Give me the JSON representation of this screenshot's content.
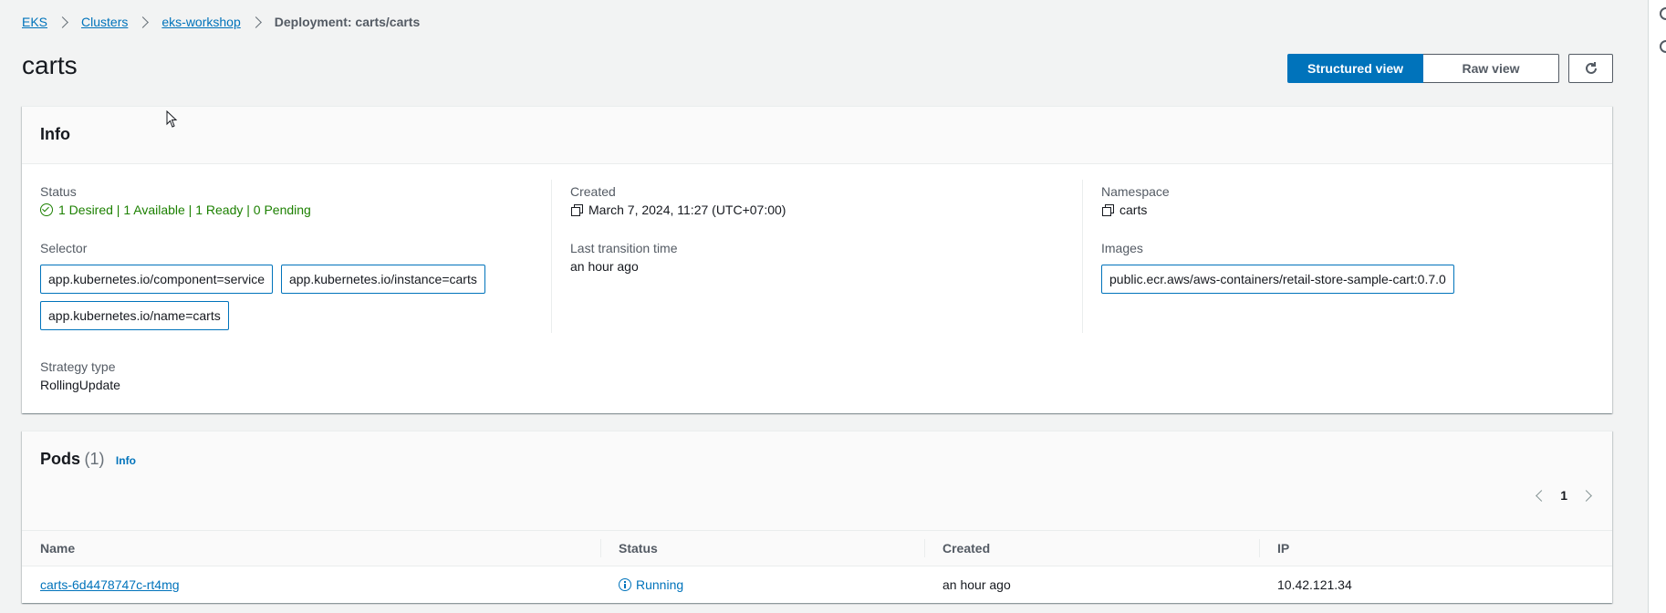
{
  "breadcrumb": {
    "items": [
      {
        "label": "EKS"
      },
      {
        "label": "Clusters"
      },
      {
        "label": "eks-workshop"
      }
    ],
    "current": "Deployment: carts/carts"
  },
  "page": {
    "title": "carts"
  },
  "toolbar": {
    "structured_view": "Structured view",
    "raw_view": "Raw view"
  },
  "info": {
    "title": "Info",
    "status": {
      "label": "Status",
      "value": "1 Desired | 1 Available | 1 Ready | 0 Pending"
    },
    "selector": {
      "label": "Selector",
      "tags": [
        "app.kubernetes.io/component=service",
        "app.kubernetes.io/instance=carts",
        "app.kubernetes.io/name=carts"
      ]
    },
    "strategy": {
      "label": "Strategy type",
      "value": "RollingUpdate"
    },
    "created": {
      "label": "Created",
      "value": "March 7, 2024, 11:27 (UTC+07:00)"
    },
    "last_transition": {
      "label": "Last transition time",
      "value": "an hour ago"
    },
    "namespace": {
      "label": "Namespace",
      "value": "carts"
    },
    "images": {
      "label": "Images",
      "value": "public.ecr.aws/aws-containers/retail-store-sample-cart:0.7.0"
    }
  },
  "pods": {
    "title": "Pods",
    "count": "(1)",
    "info_link": "Info",
    "page_number": "1",
    "columns": [
      "Name",
      "Status",
      "Created",
      "IP"
    ],
    "rows": [
      {
        "name": "carts-6d4478747c-rt4mg",
        "status": "Running",
        "created": "an hour ago",
        "ip": "10.42.121.34"
      }
    ]
  },
  "colors": {
    "link": "#0073bb",
    "success": "#1d8102",
    "primary_button": "#0073bb",
    "background": "#f2f3f3"
  }
}
